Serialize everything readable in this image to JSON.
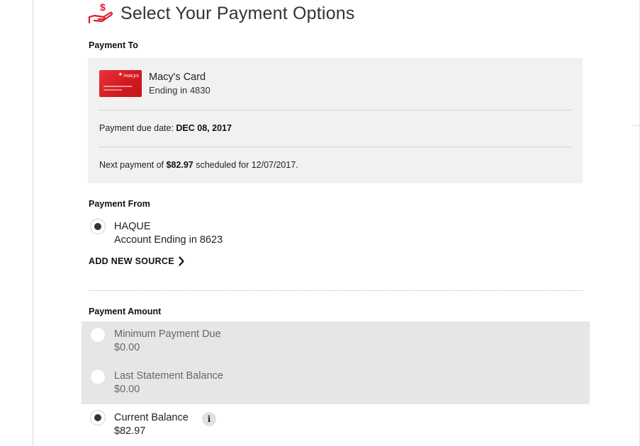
{
  "header": {
    "title": "Select Your Payment Options",
    "icon": "hand-dollar-icon",
    "accent": "#e21a2c"
  },
  "payment_to": {
    "label": "Payment To",
    "card": {
      "name": "Macy's Card",
      "ending": "Ending in 4830",
      "logo_text": "macys"
    },
    "due_prefix": "Payment due date: ",
    "due_date": "DEC 08, 2017",
    "next_prefix": "Next payment of ",
    "next_amount": "$82.97",
    "next_suffix": " scheduled for 12/07/2017."
  },
  "payment_from": {
    "label": "Payment From",
    "account_name": "HAQUE",
    "account_ending": "Account Ending in 8623",
    "selected": true,
    "add_new_label": "ADD NEW SOURCE"
  },
  "payment_amount": {
    "label": "Payment Amount",
    "options": [
      {
        "title": "Minimum Payment Due",
        "value": "$0.00",
        "selected": false,
        "disabled": true
      },
      {
        "title": "Last Statement Balance",
        "value": "$0.00",
        "selected": false,
        "disabled": true
      },
      {
        "title": "Current Balance",
        "value": "$82.97",
        "selected": true,
        "disabled": false,
        "info": "i"
      }
    ]
  }
}
